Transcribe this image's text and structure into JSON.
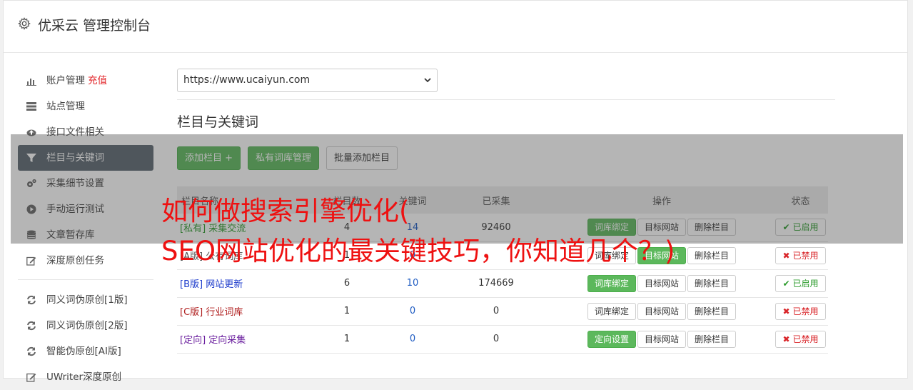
{
  "app": {
    "title": "优采云 管理控制台",
    "icon": "gear-icon"
  },
  "sidebar": {
    "items": [
      {
        "label": "账户管理",
        "extra": "充值",
        "icon": "bar-chart-icon"
      },
      {
        "label": "站点管理",
        "icon": "server-icon"
      },
      {
        "label": "接口文件相关",
        "icon": "cloud-upload-icon"
      },
      {
        "label": "栏目与关键词",
        "icon": "filter-icon",
        "active": true
      },
      {
        "label": "采集细节设置",
        "icon": "cogs-icon"
      },
      {
        "label": "手动运行测试",
        "icon": "play-circle-icon"
      },
      {
        "label": "文章暂存库",
        "icon": "database-icon"
      },
      {
        "label": "深度原创任务",
        "icon": "edit-icon"
      }
    ],
    "items2": [
      {
        "label": "同义词伪原创[1版]",
        "icon": "refresh-icon"
      },
      {
        "label": "同义词伪原创[2版]",
        "icon": "refresh-icon"
      },
      {
        "label": "智能伪原创[AI版]",
        "icon": "refresh-icon"
      },
      {
        "label": "UWriter深度原创",
        "icon": "edit-icon"
      }
    ]
  },
  "main": {
    "site_select": "https://www.ucaiyun.com",
    "section_title": "栏目与关键词",
    "buttons": {
      "add_column": "添加栏目 +",
      "private_lib": "私有词库管理",
      "batch_add": "批量添加栏目"
    },
    "table": {
      "headers": [
        "栏目名称",
        "栏目数",
        "关键词",
        "已采集",
        "操作",
        "状态"
      ],
      "rows": [
        {
          "tag": "[私有]",
          "name": "采集交流",
          "cols": "4",
          "keywords": "14",
          "collected": "92460",
          "op1": "词库绑定",
          "op1_green": true,
          "op2": "目标网站",
          "op3": "删除栏目",
          "status": "已启用",
          "on": true
        },
        {
          "tag": "[A版]",
          "name": "公有词库",
          "cols": "1",
          "keywords": "0",
          "collected": "",
          "op1": "词库绑定",
          "op1_green": false,
          "op2": "目标网站",
          "op2_green": true,
          "op3": "删除栏目",
          "status": "已禁用",
          "on": false
        },
        {
          "tag": "[B版]",
          "name": "网站更新",
          "cols": "6",
          "keywords": "10",
          "collected": "174669",
          "op1": "词库绑定",
          "op1_green": true,
          "op2": "目标网站",
          "op3": "删除栏目",
          "status": "已启用",
          "on": true
        },
        {
          "tag": "[C版]",
          "name": "行业词库",
          "cols": "1",
          "keywords": "0",
          "collected": "0",
          "op1": "词库绑定",
          "op1_green": false,
          "op2": "目标网站",
          "op3": "删除栏目",
          "status": "已禁用",
          "on": false
        },
        {
          "tag": "[定向]",
          "name": "定向采集",
          "cols": "1",
          "keywords": "0",
          "collected": "0",
          "op1": "定向设置",
          "op1_green": true,
          "op2": "目标网站",
          "op3": "删除栏目",
          "status": "已禁用",
          "on": false
        }
      ]
    }
  },
  "overlay": {
    "line1": "如何做搜索引擎优化(",
    "line2": "SEO网站优化的最关键技巧，你知道几个？)",
    "color": "#ee1111"
  },
  "colors": {
    "accent_green": "#5cb85c",
    "active_sidebar": "#5b6770",
    "danger": "#d9262a"
  }
}
